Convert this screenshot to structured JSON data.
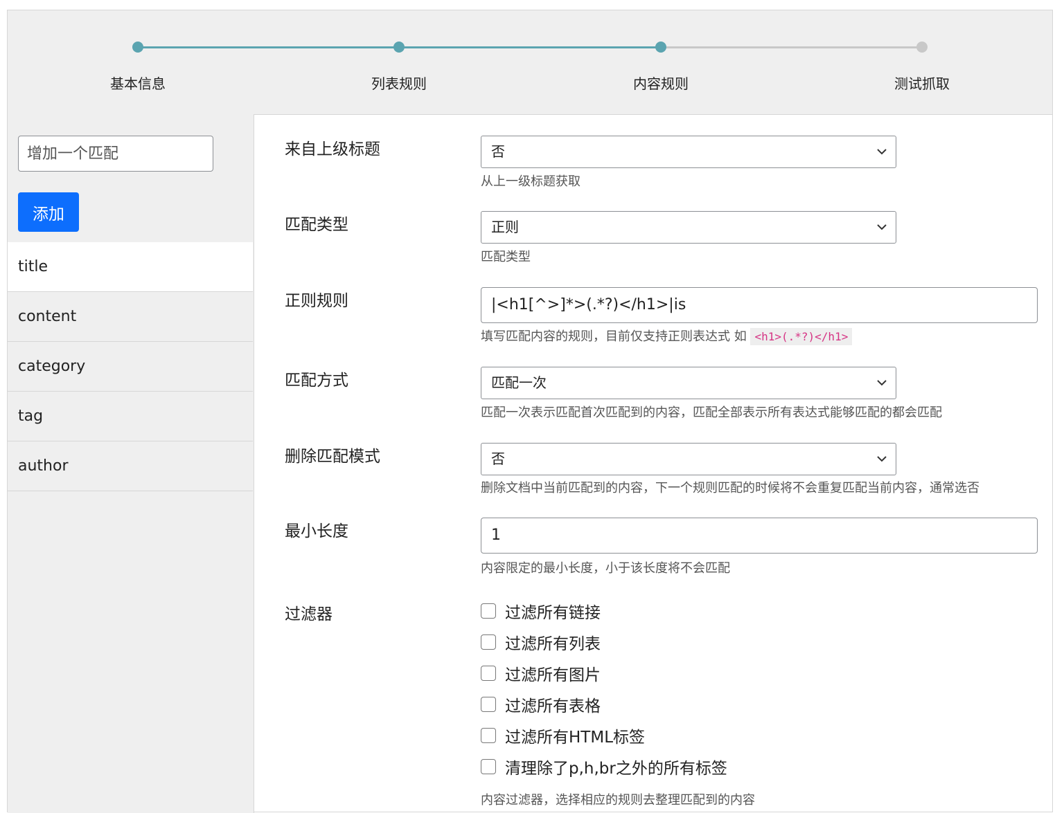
{
  "stepper": {
    "steps": [
      {
        "label": "基本信息",
        "state": "done"
      },
      {
        "label": "列表规则",
        "state": "done"
      },
      {
        "label": "内容规则",
        "state": "current"
      },
      {
        "label": "测试抓取",
        "state": "pending"
      }
    ],
    "colors": {
      "done": "#5ba4b0",
      "pending": "#c8c8c8"
    }
  },
  "sidebar": {
    "input_placeholder": "增加一个匹配",
    "add_label": "添加",
    "items": [
      {
        "label": "title",
        "active": true
      },
      {
        "label": "content",
        "active": false
      },
      {
        "label": "category",
        "active": false
      },
      {
        "label": "tag",
        "active": false
      },
      {
        "label": "author",
        "active": false
      }
    ]
  },
  "form": {
    "from_parent": {
      "label": "来自上级标题",
      "value": "否",
      "help": "从上一级标题获取"
    },
    "match_type": {
      "label": "匹配类型",
      "value": "正则",
      "help": "匹配类型"
    },
    "regex_rule": {
      "label": "正则规则",
      "value": "|<h1[^>]*>(.*?)</h1>|is",
      "help": "填写匹配内容的规则，目前仅支持正则表达式 如",
      "help_code": "<h1>(.*?)</h1>"
    },
    "match_mode": {
      "label": "匹配方式",
      "value": "匹配一次",
      "help": "匹配一次表示匹配首次匹配到的内容，匹配全部表示所有表达式能够匹配的都会匹配"
    },
    "delete_mode": {
      "label": "删除匹配模式",
      "value": "否",
      "help": "删除文档中当前匹配到的内容，下一个规则匹配的时候将不会重复匹配当前内容，通常选否"
    },
    "min_length": {
      "label": "最小长度",
      "value": "1",
      "help": "内容限定的最小长度，小于该长度将不会匹配"
    },
    "filters": {
      "label": "过滤器",
      "options": [
        {
          "label": "过滤所有链接",
          "checked": false
        },
        {
          "label": "过滤所有列表",
          "checked": false
        },
        {
          "label": "过滤所有图片",
          "checked": false
        },
        {
          "label": "过滤所有表格",
          "checked": false
        },
        {
          "label": "过滤所有HTML标签",
          "checked": false
        },
        {
          "label": "清理除了p,h,br之外的所有标签",
          "checked": false
        }
      ],
      "help": "内容过滤器，选择相应的规则去整理匹配到的内容"
    }
  },
  "icons": {
    "select_arrow": "chevron-down-icon",
    "checkbox": "checkbox-icon"
  },
  "colors": {
    "primary_button": "#0d6efd",
    "code_text": "#d63384",
    "panel_bg": "#efefef"
  }
}
